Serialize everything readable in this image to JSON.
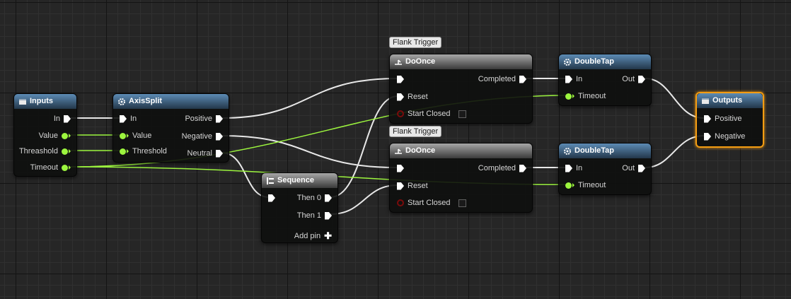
{
  "nodes": {
    "inputs": {
      "title": "Inputs",
      "pins": [
        "In",
        "Value",
        "Threashold",
        "Timeout"
      ]
    },
    "axissplit": {
      "title": "AxisSplit",
      "in": [
        "In",
        "Value",
        "Threshold"
      ],
      "out": [
        "Positive",
        "Negative",
        "Neutral"
      ]
    },
    "sequence": {
      "title": "Sequence",
      "out": [
        "Then 0",
        "Then 1"
      ],
      "add_pin": "Add pin"
    },
    "doonce_top": {
      "comment": "Flank Trigger",
      "title": "DoOnce",
      "out": "Completed",
      "in": [
        "Reset",
        "Start Closed"
      ]
    },
    "doonce_bottom": {
      "comment": "Flank Trigger",
      "title": "DoOnce",
      "out": "Completed",
      "in": [
        "Reset",
        "Start Closed"
      ]
    },
    "doubletap_top": {
      "title": "DoubleTap",
      "in": [
        "In",
        "Timeout"
      ],
      "out": "Out"
    },
    "doubletap_bottom": {
      "title": "DoubleTap",
      "in": [
        "In",
        "Timeout"
      ],
      "out": "Out"
    },
    "outputs": {
      "title": "Outputs",
      "pins": [
        "Positive",
        "Negative"
      ]
    }
  },
  "colors": {
    "exec_wire": "#e8e8e8",
    "data_wire": "#9cf53e",
    "function_header": "#5c8bb5",
    "macro_header": "#a7a7a7",
    "selected_border": "#f39c12"
  }
}
